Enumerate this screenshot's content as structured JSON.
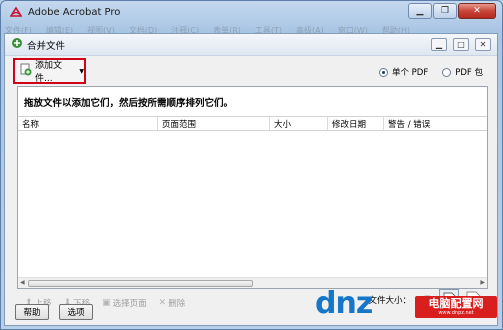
{
  "app": {
    "title": "Adobe Acrobat Pro"
  },
  "menubar": [
    "文件(F)",
    "编辑(E)",
    "视图(V)",
    "文档(D)",
    "注释(C)",
    "表单(R)",
    "工具(T)",
    "高级(A)",
    "窗口(W)",
    "帮助(H)"
  ],
  "dialog": {
    "title": "合并文件",
    "add_files_label": "添加文件...",
    "radio_single_pdf": "单个 PDF",
    "radio_pdf_package": "PDF 包",
    "instructions": "拖放文件以添加它们，然后按所需顺序排列它们。",
    "columns": [
      "名称",
      "页面范围",
      "大小",
      "修改日期",
      "警告 / 错误"
    ],
    "actions": {
      "move_up": "上移",
      "move_down": "下移",
      "choose_pages": "选择页面",
      "delete": "删除"
    },
    "file_size_label": "文件大小：",
    "help_button": "帮助",
    "options_button": "选项"
  },
  "watermark": {
    "site": "dnz.net",
    "badge_main": "电脑配置网",
    "badge_sub": "www.dnpz.net"
  }
}
